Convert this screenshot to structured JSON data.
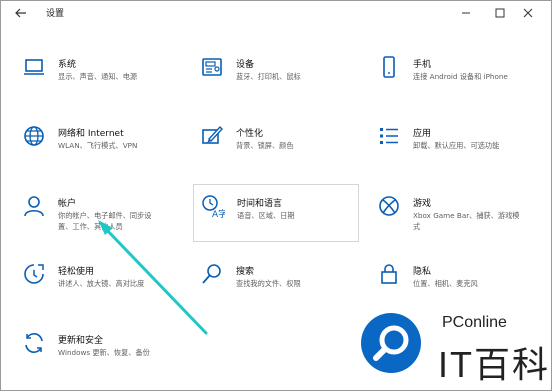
{
  "window": {
    "title": "设置",
    "back_icon": "back-arrow-icon",
    "controls": [
      "minimize-icon",
      "maximize-icon",
      "close-icon"
    ]
  },
  "tiles": [
    {
      "icon": "laptop-icon",
      "name": "系统",
      "desc": [
        "显示、声音、通知、电源"
      ]
    },
    {
      "icon": "devices-icon",
      "name": "设备",
      "desc": [
        "蓝牙、打印机、鼠标"
      ]
    },
    {
      "icon": "phone-icon",
      "name": "手机",
      "desc": [
        "连接 Android 设备和 iPhone"
      ]
    },
    {
      "icon": "globe-icon",
      "name": "网络和 Internet",
      "desc": [
        "WLAN、飞行模式、VPN"
      ]
    },
    {
      "icon": "personalization-icon",
      "name": "个性化",
      "desc": [
        "背景、锁屏、颜色"
      ]
    },
    {
      "icon": "apps-list-icon",
      "name": "应用",
      "desc": [
        "卸载、默认应用、可选功能"
      ]
    },
    {
      "icon": "account-icon",
      "name": "帐户",
      "desc": [
        "你的帐户、电子邮件、同步设",
        "置、工作、其他人员"
      ]
    },
    {
      "icon": "time-language-icon",
      "name": "时间和语言",
      "desc": [
        "语音、区域、日期"
      ]
    },
    {
      "icon": "xbox-icon",
      "name": "游戏",
      "desc": [
        "Xbox Game Bar、捕获、游戏模",
        "式"
      ]
    },
    {
      "icon": "ease-of-access-icon",
      "name": "轻松使用",
      "desc": [
        "讲述人、放大镜、高对比度"
      ]
    },
    {
      "icon": "search-icon",
      "name": "搜索",
      "desc": [
        "查找我的文件、权限"
      ]
    },
    {
      "icon": "lock-icon",
      "name": "隐私",
      "desc": [
        "位置、相机、麦克风"
      ]
    },
    {
      "icon": "update-icon",
      "name": "更新和安全",
      "desc": [
        "Windows 更新、恢复、备份"
      ]
    }
  ],
  "watermark": {
    "top": "PConline",
    "bottom": "IT百科"
  },
  "colors": {
    "accent": "#0a5fb4",
    "arrow": "#21c6c6",
    "brand": "#0b67c4"
  }
}
